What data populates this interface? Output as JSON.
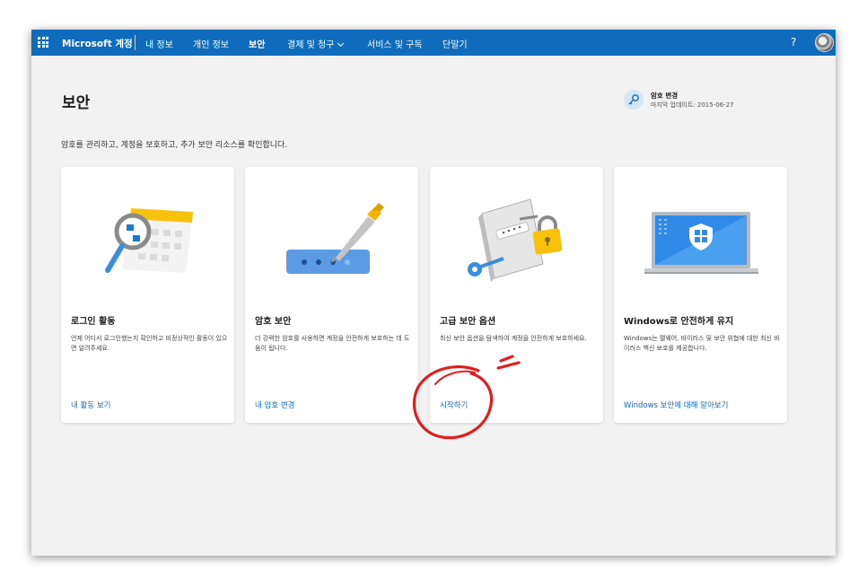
{
  "topbar": {
    "brand": "Microsoft 계정",
    "nav": [
      "내 정보",
      "개인 정보",
      "보안",
      "결제 및 청구",
      "서비스 및 구독",
      "단말기"
    ],
    "help": "?",
    "accent": "#0f6cbd"
  },
  "header": {
    "title": "보안",
    "password": {
      "label": "암호 변경",
      "updated": "마지막 업데이트: 2015-06-27"
    },
    "description": "암호를 관리하고, 계정을 보호하고, 추가 보안 리소스를 확인합니다."
  },
  "cards": [
    {
      "icon": "magnifier-calendar-icon",
      "title": "로그인 활동",
      "desc": "언제 어디서 로그인했는지 확인하고 비정상적인 활동이 있으면 알려주세요.",
      "link": "내 활동 보기"
    },
    {
      "icon": "password-pen-icon",
      "title": "암호 보안",
      "desc": "더 강력한 암호를 사용하면 계정을 안전하게 보호하는 데 도움이 됩니다.",
      "link": "내 암호 변경"
    },
    {
      "icon": "lock-key-icon",
      "title": "고급 보안 옵션",
      "desc": "최신 보안 옵션을 탐색하여 계정을 안전하게 보호하세요.",
      "link": "시작하기"
    },
    {
      "icon": "windows-shield-laptop-icon",
      "title": "Windows로 안전하게 유지",
      "desc": "Windows는 멜웨어, 바이러스 및 보안 위협에 대한 최신 바이러스 백신 보호를 제공합니다.",
      "link": "Windows 보안에 대해 알아보기"
    }
  ]
}
